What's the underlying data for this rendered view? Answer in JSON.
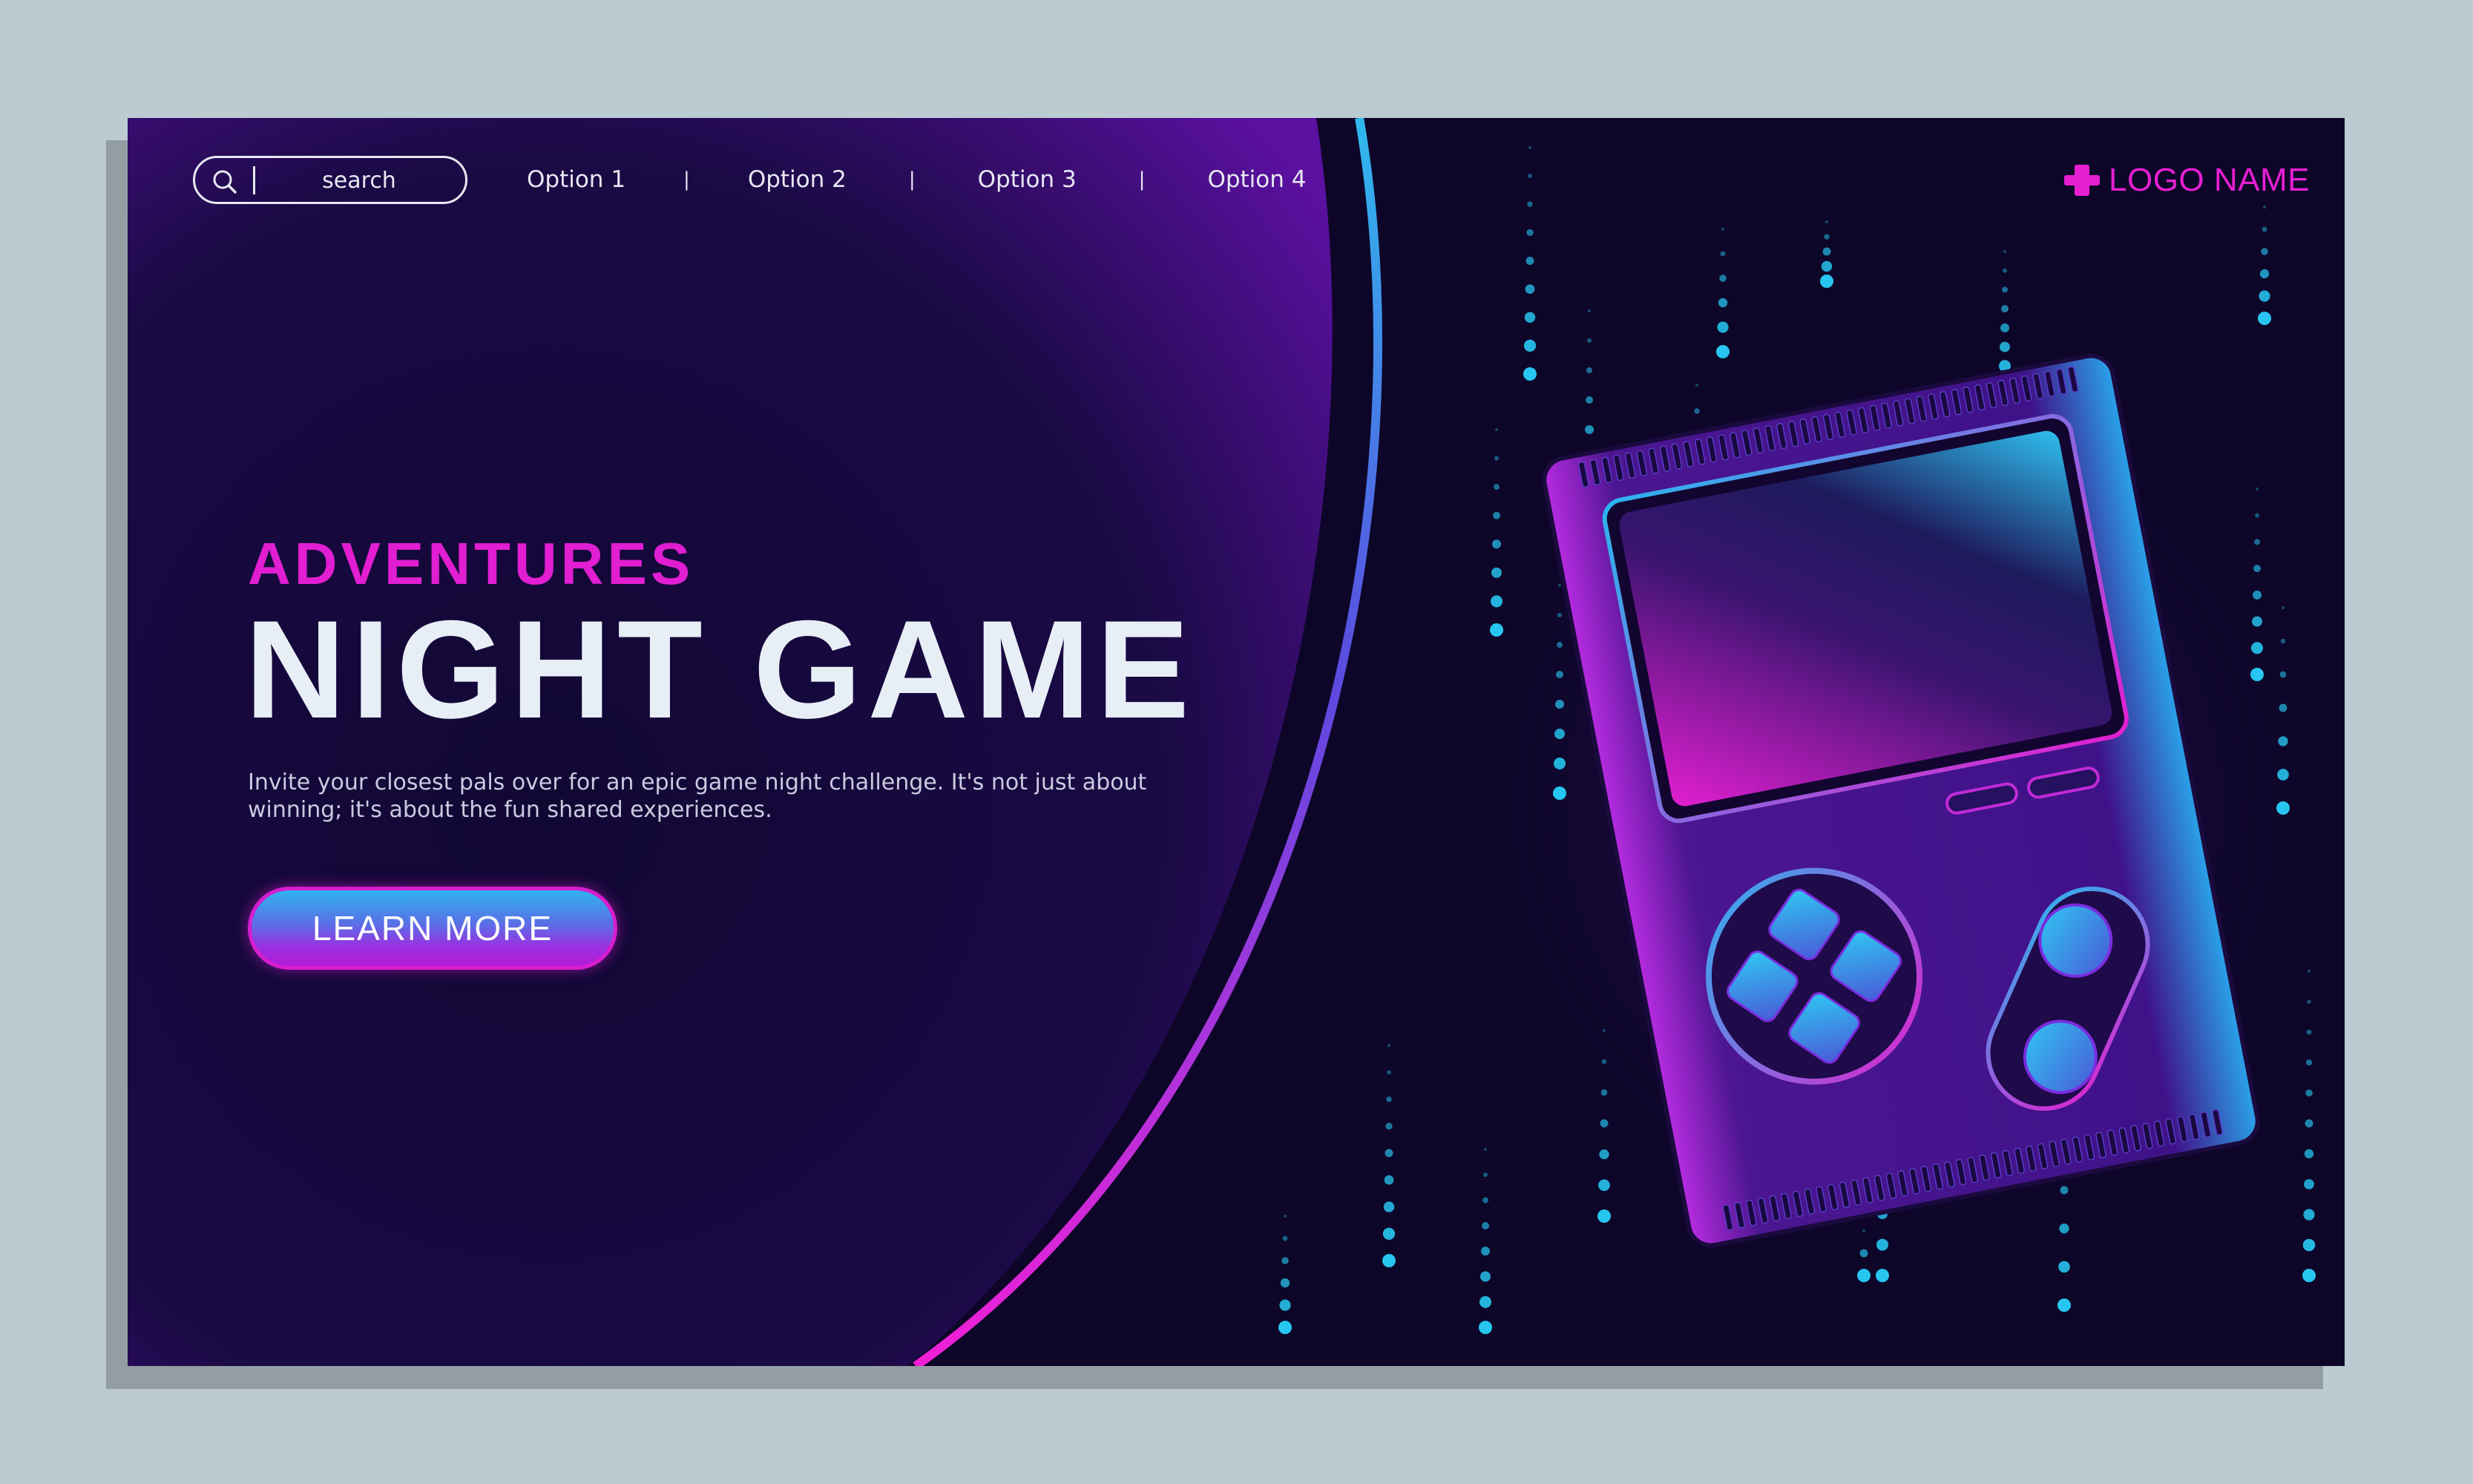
{
  "search": {
    "placeholder": "search"
  },
  "nav": {
    "items": [
      "Option 1",
      "Option 2",
      "Option 3",
      "Option 4"
    ],
    "separator": "|"
  },
  "logo": {
    "text": "LOGO NAME",
    "icon": "plus-icon"
  },
  "hero": {
    "eyebrow": "ADVENTURES",
    "title": "NIGHT GAME",
    "description": "Invite your closest pals over for an epic game night challenge. It's not just about winning; it's about the fun shared experiences.",
    "cta_label": "LEARN MORE"
  },
  "illustration": {
    "name": "handheld-game-console",
    "icons": [
      "dpad-icon",
      "round-buttons",
      "select-start-buttons"
    ]
  },
  "colors": {
    "background": "#0d0629",
    "accent_pink": "#e11ed2",
    "accent_cyan": "#27c6f0",
    "headline": "#e8eef6",
    "outer_bg": "#bccad2"
  }
}
